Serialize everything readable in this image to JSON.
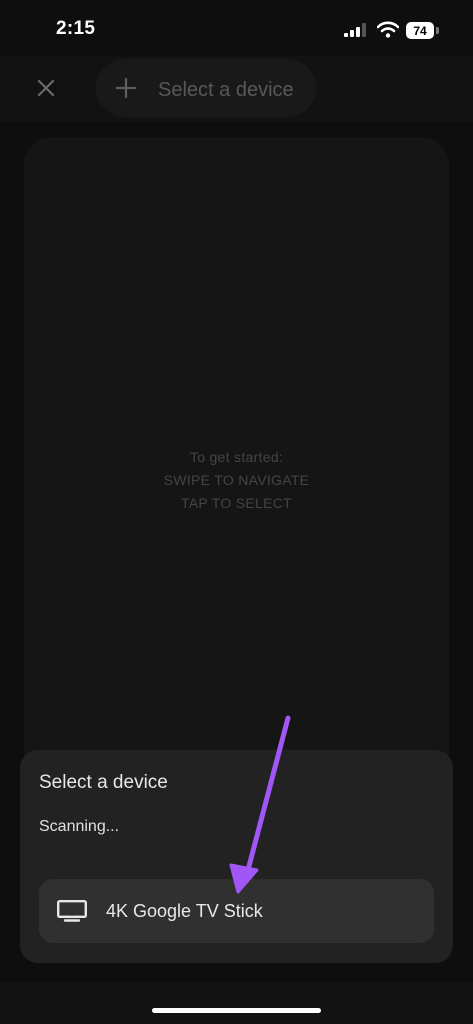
{
  "status_bar": {
    "time": "2:15",
    "battery": "74",
    "icons": [
      "signal-icon",
      "wifi-icon",
      "battery-icon"
    ]
  },
  "top_bar": {
    "close_icon": "close-icon",
    "select_device_label": "Select a device",
    "plus_icon": "plus-icon"
  },
  "touchpad": {
    "hint_line_1": "To get started:",
    "hint_line_2": "SWIPE TO NAVIGATE",
    "hint_line_3": "TAP TO SELECT"
  },
  "sheet": {
    "title": "Select a device",
    "status": "Scanning...",
    "devices": [
      {
        "label": "4K Google TV Stick",
        "icon": "tv-icon"
      }
    ]
  },
  "annotation": {
    "color": "#a157f5"
  }
}
